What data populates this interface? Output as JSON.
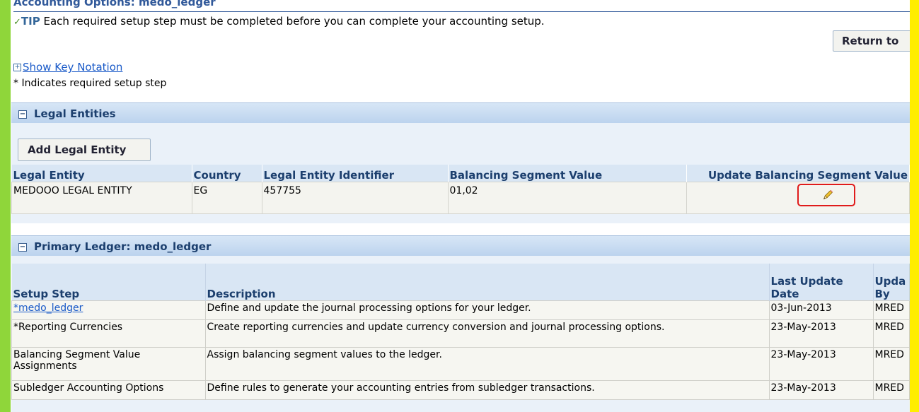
{
  "page": {
    "title": "Accounting Options: medo_ledger",
    "tip_label": "TIP",
    "tip_text": " Each required setup step must be completed before you can complete your accounting setup.",
    "return_button": "Return to",
    "show_key_notation": "Show Key Notation",
    "required_note": "* Indicates required setup step"
  },
  "legal_entities": {
    "header": "Legal Entities",
    "add_button": "Add Legal Entity",
    "columns": [
      "Legal Entity",
      "Country",
      "Legal Entity Identifier",
      "Balancing Segment Value",
      "Update Balancing Segment Value"
    ],
    "rows": [
      {
        "legal_entity": "MEDOOO LEGAL ENTITY",
        "country": "EG",
        "identifier": "457755",
        "bsv": "01,02",
        "update_icon": "pencil-icon"
      }
    ]
  },
  "primary_ledger": {
    "header": "Primary Ledger: medo_ledger",
    "columns": [
      "Setup Step",
      "Description",
      "Last Update Date",
      "Upda By"
    ],
    "rows": [
      {
        "step": "*medo_ledger",
        "step_is_link": true,
        "description": "Define and update the journal processing options for your ledger.",
        "date": "03-Jun-2013",
        "by": "MRED"
      },
      {
        "step": "*Reporting Currencies",
        "step_is_link": false,
        "description": "Create reporting currencies and update currency conversion and journal processing options.",
        "date": "23-May-2013",
        "by": "MRED"
      },
      {
        "step": "Balancing Segment Value Assignments",
        "step_is_link": false,
        "description": "Assign balancing segment values to the ledger.",
        "date": "23-May-2013",
        "by": "MRED"
      },
      {
        "step": "Subledger Accounting Options",
        "step_is_link": false,
        "description": "Define rules to generate your accounting entries from subledger transactions.",
        "date": "23-May-2013",
        "by": "MRED"
      }
    ]
  },
  "colors": {
    "frame_green": "#8fd63a",
    "frame_yellow": "#ffee00",
    "header_blue": "#1c3f6e",
    "link_blue": "#1a5ac8",
    "highlight_red": "#e01b1b"
  }
}
